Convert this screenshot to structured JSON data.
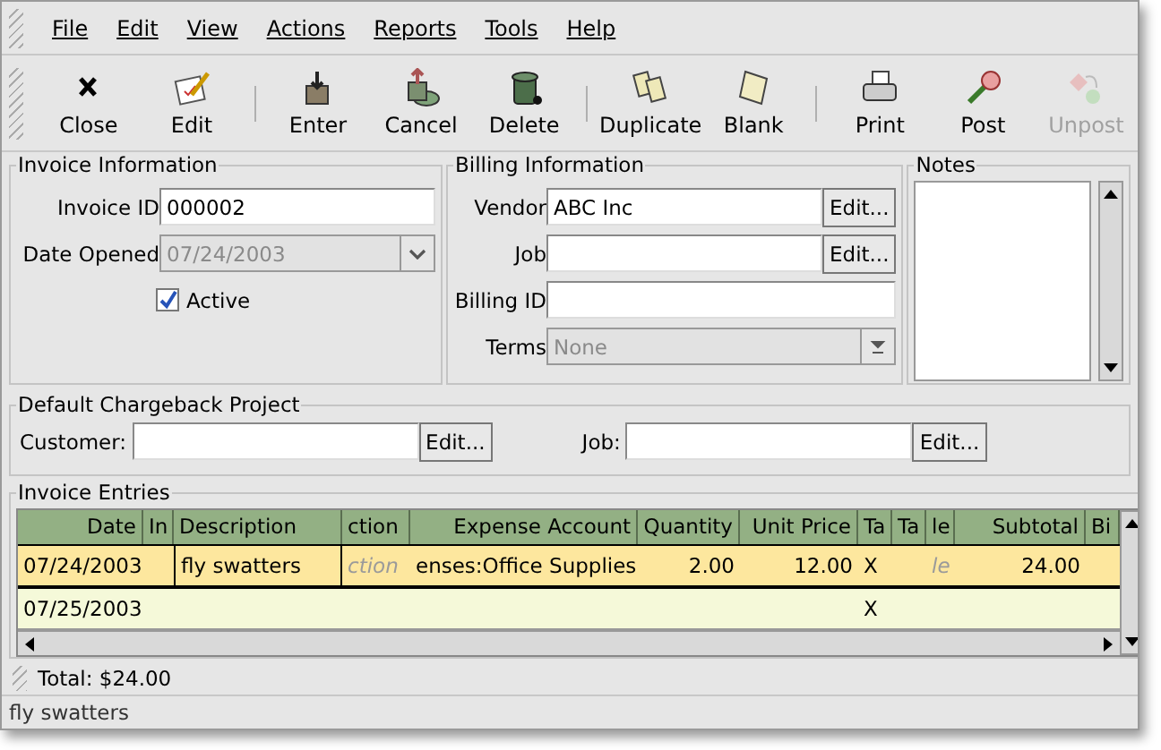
{
  "menu": [
    "File",
    "Edit",
    "View",
    "Actions",
    "Reports",
    "Tools",
    "Help"
  ],
  "toolbar": [
    [
      {
        "label": "Close",
        "disabled": false
      },
      {
        "label": "Edit",
        "disabled": false
      }
    ],
    [
      {
        "label": "Enter",
        "disabled": false
      },
      {
        "label": "Cancel",
        "disabled": false
      },
      {
        "label": "Delete",
        "disabled": false
      }
    ],
    [
      {
        "label": "Duplicate",
        "disabled": false
      },
      {
        "label": "Blank",
        "disabled": false
      }
    ],
    [
      {
        "label": "Print",
        "disabled": false
      },
      {
        "label": "Post",
        "disabled": false
      },
      {
        "label": "Unpost",
        "disabled": true
      }
    ]
  ],
  "invoice_information": {
    "title": "Invoice Information",
    "invoice_id": {
      "label": "Invoice ID",
      "value": "000002"
    },
    "date_opened": {
      "label": "Date Opened",
      "value": "07/24/2003",
      "disabled": true
    },
    "active": {
      "label": "Active",
      "checked": true
    }
  },
  "billing_information": {
    "title": "Billing Information",
    "vendor": {
      "label": "Vendor",
      "value": "ABC Inc",
      "button": "Edit..."
    },
    "job": {
      "label": "Job",
      "button": "Edit..."
    },
    "billing_id": {
      "label": "Billing ID"
    },
    "terms": {
      "label": "Terms",
      "value": "None",
      "disabled": true
    }
  },
  "notes": {
    "title": "Notes"
  },
  "chargeback": {
    "title": "Default Chargeback Project",
    "customer": {
      "label": "Customer:",
      "button": "Edit..."
    },
    "job": {
      "label": "Job:",
      "button": "Edit..."
    }
  },
  "invoice_entries": {
    "title": "Invoice Entries",
    "columns": [
      "Date",
      "In",
      "Description",
      "ction",
      "Expense Account",
      "Quantity",
      "Unit Price",
      "Ta",
      "Ta",
      "le",
      "Subtotal",
      "Bi"
    ],
    "rows": [
      {
        "selected": true,
        "cells": [
          {
            "text": "07/24/2003",
            "hint": false
          },
          null,
          {
            "text": "fly swatters",
            "hint": false,
            "editing": true
          },
          {
            "text": "ction",
            "hint": true
          },
          {
            "text": "enses:Office Supplies",
            "hint": false
          },
          {
            "text": "2.00",
            "hint": false
          },
          {
            "text": "12.00",
            "hint": false
          },
          {
            "text": "X",
            "hint": false
          },
          null,
          {
            "text": "le",
            "hint": true
          },
          {
            "text": "24.00",
            "hint": false
          },
          null
        ]
      },
      {
        "selected": false,
        "cells": [
          {
            "text": "07/25/2003",
            "hint": false
          },
          null,
          null,
          null,
          null,
          null,
          null,
          {
            "text": "X",
            "hint": false
          },
          null,
          null,
          null,
          null
        ]
      }
    ]
  },
  "total": "Total: $24.00",
  "status_bar": "fly swatters"
}
